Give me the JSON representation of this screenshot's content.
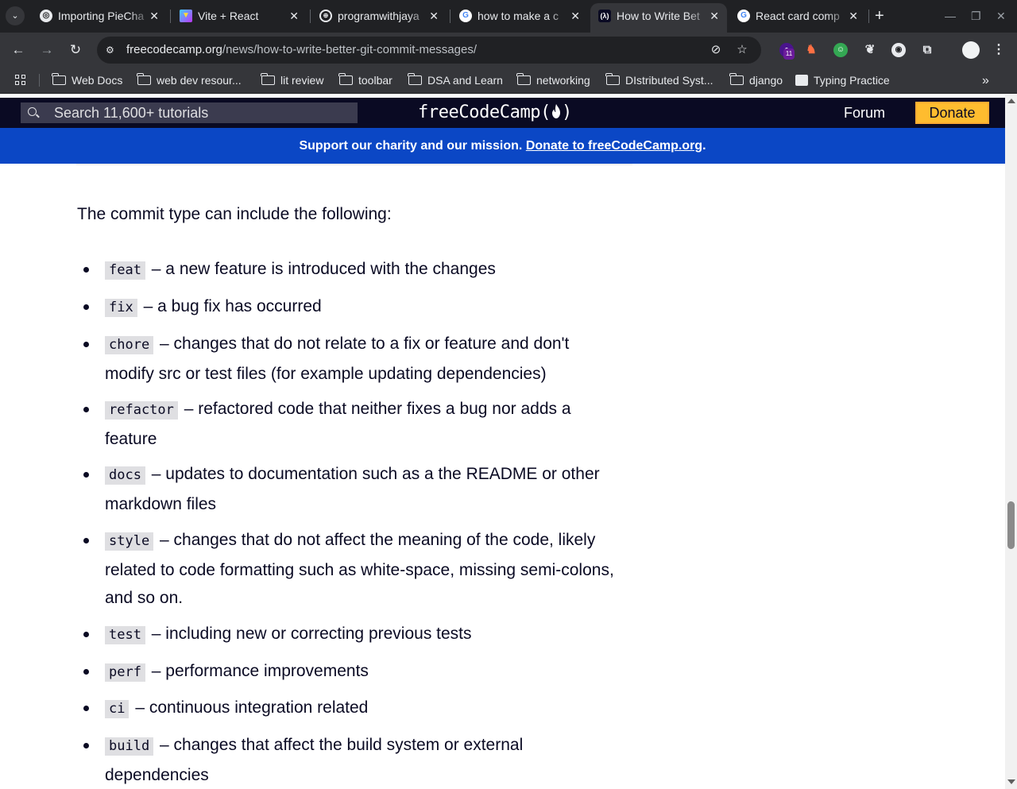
{
  "browser": {
    "tabs": [
      {
        "title": "Importing PieCha",
        "favicon": "openai-icon",
        "active": false
      },
      {
        "title": "Vite + React",
        "favicon": "vite-icon",
        "active": false
      },
      {
        "title": "programwithjaya",
        "favicon": "globe-icon",
        "active": false
      },
      {
        "title": "how to make a c",
        "favicon": "google-icon",
        "active": false
      },
      {
        "title": "How to Write Bet",
        "favicon": "freecodecamp-icon",
        "active": true
      },
      {
        "title": "React card comp",
        "favicon": "google-icon",
        "active": false
      }
    ],
    "close_glyph": "✕",
    "new_tab_glyph": "+",
    "address": {
      "domain": "freecodecamp.org",
      "path": "/news/how-to-write-better-git-commit-messages/"
    },
    "extension_badge": "11",
    "bookmarks": [
      {
        "label": "Web Docs",
        "type": "folder"
      },
      {
        "label": "web dev resour...",
        "type": "folder"
      },
      {
        "label": "lit review",
        "type": "folder"
      },
      {
        "label": "toolbar",
        "type": "folder"
      },
      {
        "label": "DSA and Learn",
        "type": "folder"
      },
      {
        "label": "networking",
        "type": "folder"
      },
      {
        "label": "DIstributed Syst...",
        "type": "folder"
      },
      {
        "label": "django",
        "type": "folder"
      },
      {
        "label": "Typing Practice",
        "type": "page"
      }
    ],
    "more_glyph": "»"
  },
  "site": {
    "search_placeholder": "Search 11,600+ tutorials",
    "logo": "freeCodeCamp(🔥)",
    "logo_text": "freeCodeCamp(",
    "logo_end": ")",
    "forum_label": "Forum",
    "donate_label": "Donate",
    "banner_text": "Support our charity and our mission.",
    "banner_link": "Donate to freeCodeCamp.org",
    "banner_end": ".",
    "colors": {
      "nav_bg": "#0a0a23",
      "banner_bg": "#0b47c5",
      "donate_bg": "#febc2f",
      "code_bg": "#dfdfe2"
    }
  },
  "article": {
    "intro": "The commit type can include the following:",
    "types": [
      {
        "code": "feat",
        "lines": [
          "– a new feature is introduced with the changes"
        ]
      },
      {
        "code": "fix",
        "lines": [
          "– a bug fix has occurred"
        ]
      },
      {
        "code": "chore",
        "lines": [
          "– changes that do not relate to a fix or feature and don't",
          "modify src or test files (for example updating dependencies)"
        ]
      },
      {
        "code": "refactor",
        "lines": [
          "– refactored code that neither fixes a bug nor adds a",
          "feature"
        ]
      },
      {
        "code": "docs",
        "lines": [
          "– updates to documentation such as a the README or other",
          "markdown files"
        ]
      },
      {
        "code": "style",
        "lines": [
          "– changes that do not affect the meaning of the code, likely",
          "related to code formatting such as white-space, missing semi-colons,",
          "and so on."
        ]
      },
      {
        "code": "test",
        "lines": [
          "– including new or correcting previous tests"
        ]
      },
      {
        "code": "perf",
        "lines": [
          "– performance improvements"
        ]
      },
      {
        "code": "ci",
        "lines": [
          "– continuous integration related"
        ]
      },
      {
        "code": "build",
        "lines": [
          "– changes that affect the build system or external",
          "dependencies"
        ]
      }
    ]
  }
}
